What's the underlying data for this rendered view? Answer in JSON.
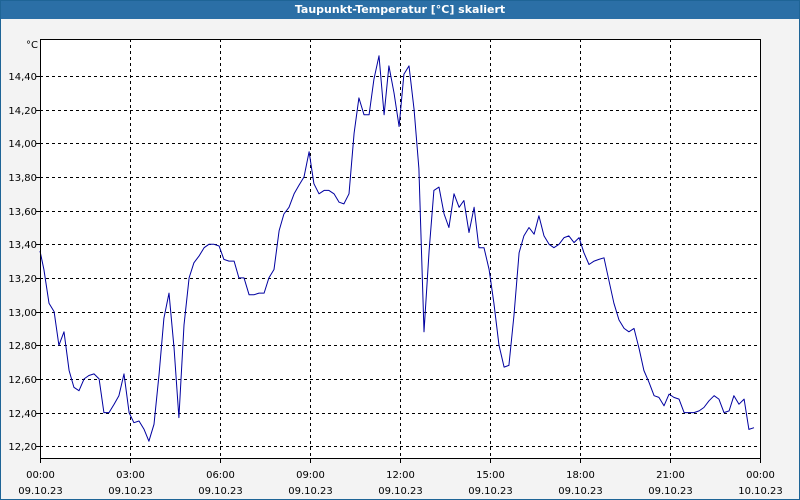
{
  "window": {
    "title": "Taupunkt-Temperatur [°C] skaliert"
  },
  "chart_data": {
    "type": "line",
    "title": "Taupunkt-Temperatur [°C] skaliert",
    "ylabel": "°C",
    "xlabel": "",
    "ylim": [
      12.13,
      14.62
    ],
    "xlim_hours": [
      0,
      24
    ],
    "grid": true,
    "line_color": "#0000a0",
    "y_ticks": [
      "12,20",
      "12,40",
      "12,60",
      "12,80",
      "13,00",
      "13,20",
      "13,40",
      "13,60",
      "13,80",
      "14,00",
      "14,20",
      "14,40"
    ],
    "y_tick_values": [
      12.2,
      12.4,
      12.6,
      12.8,
      13.0,
      13.2,
      13.4,
      13.6,
      13.8,
      14.0,
      14.2,
      14.4
    ],
    "x_ticks": [
      {
        "time": "00:00",
        "date": "09.10.23"
      },
      {
        "time": "03:00",
        "date": "09.10.23"
      },
      {
        "time": "06:00",
        "date": "09.10.23"
      },
      {
        "time": "09:00",
        "date": "09.10.23"
      },
      {
        "time": "12:00",
        "date": "09.10.23"
      },
      {
        "time": "15:00",
        "date": "09.10.23"
      },
      {
        "time": "18:00",
        "date": "09.10.23"
      },
      {
        "time": "21:00",
        "date": "09.10.23"
      },
      {
        "time": "00:00",
        "date": "10.10.23"
      }
    ],
    "series": [
      {
        "x_hours": [
          0.0,
          0.13,
          0.3,
          0.47,
          0.63,
          0.8,
          0.97,
          1.13,
          1.3,
          1.47,
          1.63,
          1.8,
          1.97,
          2.13,
          2.3,
          2.47,
          2.63,
          2.8,
          2.97,
          3.13,
          3.3,
          3.47,
          3.63,
          3.8,
          3.97,
          4.13,
          4.3,
          4.47,
          4.63,
          4.8,
          4.97,
          5.13,
          5.3,
          5.47,
          5.63,
          5.8,
          5.97,
          6.13,
          6.3,
          6.47,
          6.63,
          6.8,
          6.97,
          7.13,
          7.3,
          7.47,
          7.63,
          7.8,
          7.97,
          8.13,
          8.3,
          8.47,
          8.63,
          8.8,
          8.97,
          9.13,
          9.3,
          9.47,
          9.63,
          9.8,
          9.97,
          10.13,
          10.3,
          10.47,
          10.63,
          10.8,
          10.97,
          11.13,
          11.3,
          11.47,
          11.63,
          11.8,
          11.97,
          12.13,
          12.3,
          12.47,
          12.63,
          12.8,
          12.97,
          13.13,
          13.3,
          13.47,
          13.63,
          13.8,
          13.97,
          14.13,
          14.3,
          14.47,
          14.63,
          14.8,
          14.97,
          15.13,
          15.3,
          15.47,
          15.63,
          15.8,
          15.97,
          16.13,
          16.3,
          16.47,
          16.63,
          16.8,
          16.97,
          17.13,
          17.3,
          17.47,
          17.63,
          17.8,
          17.97,
          18.13,
          18.3,
          18.47,
          18.63,
          18.8,
          18.97,
          19.13,
          19.3,
          19.47,
          19.63,
          19.8,
          19.97,
          20.13,
          20.3,
          20.47,
          20.63,
          20.8,
          20.97,
          21.13,
          21.3,
          21.47,
          21.63,
          21.8,
          21.97,
          22.13,
          22.3,
          22.47,
          22.63,
          22.8,
          22.97,
          23.13,
          23.3,
          23.47,
          23.63,
          23.8,
          23.97
        ],
        "y_values": [
          13.36,
          13.25,
          13.05,
          13.0,
          12.8,
          12.88,
          12.65,
          12.55,
          12.53,
          12.6,
          12.62,
          12.63,
          12.6,
          12.4,
          12.4,
          12.45,
          12.5,
          12.63,
          12.4,
          12.34,
          12.35,
          12.3,
          12.23,
          12.33,
          12.63,
          12.96,
          13.11,
          12.78,
          12.37,
          12.92,
          13.2,
          13.29,
          13.33,
          13.38,
          13.4,
          13.4,
          13.39,
          13.31,
          13.3,
          13.3,
          13.2,
          13.2,
          13.1,
          13.1,
          13.11,
          13.11,
          13.2,
          13.25,
          13.48,
          13.58,
          13.62,
          13.7,
          13.75,
          13.8,
          13.95,
          13.76,
          13.7,
          13.72,
          13.72,
          13.7,
          13.65,
          13.64,
          13.7,
          14.06,
          14.27,
          14.17,
          14.17,
          14.38,
          14.52,
          14.17,
          14.46,
          14.3,
          14.1,
          14.41,
          14.46,
          14.2,
          13.85,
          12.88,
          13.36,
          13.72,
          13.74,
          13.58,
          13.5,
          13.7,
          13.62,
          13.66,
          13.47,
          13.62,
          13.38,
          13.38,
          13.25,
          13.05,
          12.8,
          12.67,
          12.68,
          12.98,
          13.35,
          13.45,
          13.5,
          13.46,
          13.57,
          13.45,
          13.4,
          13.38,
          13.4,
          13.44,
          13.45,
          13.41,
          13.44,
          13.35,
          13.28,
          13.3,
          13.31,
          13.32,
          13.18,
          13.05,
          12.95,
          12.9,
          12.88,
          12.9,
          12.78,
          12.65,
          12.58,
          12.5,
          12.49,
          12.44,
          12.51,
          12.49,
          12.48,
          12.4,
          12.4,
          12.4,
          12.41,
          12.43,
          12.47,
          12.5,
          12.48,
          12.4,
          12.41,
          12.5,
          12.45,
          12.48,
          12.3,
          12.31
        ]
      }
    ]
  }
}
